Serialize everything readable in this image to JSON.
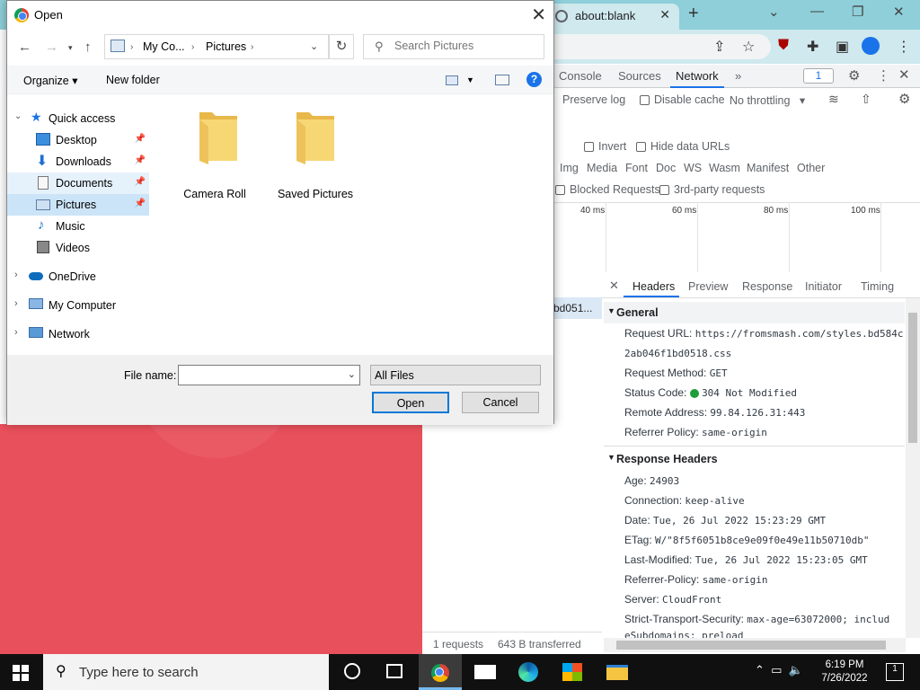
{
  "browser": {
    "tab_title": "about:blank",
    "new_tab_symbol": "+",
    "close_tab_symbol": "✕"
  },
  "devtools": {
    "tabs": [
      "Console",
      "Sources",
      "Network"
    ],
    "more_tabs": "»",
    "message_count": "1",
    "preserve_log": "Preserve log",
    "disable_cache": "Disable cache",
    "throttling": "No throttling",
    "invert": "Invert",
    "hide_data_urls": "Hide data URLs",
    "filters": [
      "Img",
      "Media",
      "Font",
      "Doc",
      "WS",
      "Wasm",
      "Manifest",
      "Other"
    ],
    "blocked_requests": "Blocked Requests",
    "third_party": "3rd-party requests",
    "timeline_ticks": [
      "40 ms",
      "60 ms",
      "80 ms",
      "100 ms"
    ],
    "request_name": "bd051...",
    "detail_tabs": [
      "Headers",
      "Preview",
      "Response",
      "Initiator",
      "Timing"
    ],
    "general": {
      "title": "General",
      "request_url_label": "Request URL:",
      "request_url": "https://fromsmash.com/styles.bd584c",
      "request_url_cont": "2ab046f1bd0518.css",
      "request_method_label": "Request Method:",
      "request_method": "GET",
      "status_code_label": "Status Code:",
      "status_code": "304 Not Modified",
      "remote_address_label": "Remote Address:",
      "remote_address": "99.84.126.31:443",
      "referrer_policy_label": "Referrer Policy:",
      "referrer_policy": "same-origin"
    },
    "response_headers": {
      "title": "Response Headers",
      "rows": [
        {
          "k": "Age:",
          "v": "24903"
        },
        {
          "k": "Connection:",
          "v": "keep-alive"
        },
        {
          "k": "Date:",
          "v": "Tue, 26 Jul 2022 15:23:29 GMT"
        },
        {
          "k": "ETag:",
          "v": "W/\"8f5f6051b8ce9e09f0e49e11b50710db\""
        },
        {
          "k": "Last-Modified:",
          "v": "Tue, 26 Jul 2022 15:23:05 GMT"
        },
        {
          "k": "Referrer-Policy:",
          "v": "same-origin"
        },
        {
          "k": "Server:",
          "v": "CloudFront"
        },
        {
          "k": "Strict-Transport-Security:",
          "v": "max-age=63072000; includ"
        },
        {
          "k": "",
          "v": "eSubdomains; preload"
        }
      ]
    },
    "status": {
      "requests": "1 requests",
      "transferred": "643 B transferred"
    }
  },
  "dialog": {
    "title": "Open",
    "path": [
      "My Co...",
      "Pictures"
    ],
    "search_placeholder": "Search Pictures",
    "organize": "Organize ▾",
    "new_folder": "New folder",
    "sidebar": [
      {
        "label": "Quick access"
      },
      {
        "label": "Desktop"
      },
      {
        "label": "Downloads"
      },
      {
        "label": "Documents"
      },
      {
        "label": "Pictures"
      },
      {
        "label": "Music"
      },
      {
        "label": "Videos"
      },
      {
        "label": "OneDrive"
      },
      {
        "label": "My Computer"
      },
      {
        "label": "Network"
      }
    ],
    "files": [
      {
        "label": "Camera Roll"
      },
      {
        "label": "Saved Pictures"
      }
    ],
    "file_name_label": "File name:",
    "file_name_value": "",
    "file_type": "All Files",
    "open_button": "Open",
    "cancel_button": "Cancel"
  },
  "taskbar": {
    "search_placeholder": "Type here to search",
    "time": "6:19 PM",
    "date": "7/26/2022",
    "notification_count": "1"
  },
  "colors": {
    "accent": "#0078d7",
    "page_bg": "#e8505b",
    "tabstrip": "#8ecfd9",
    "status_ok": "#1e9e3a"
  },
  "icons": [
    "chrome-icon",
    "globe-icon",
    "close-icon",
    "plus-icon",
    "minimize-icon",
    "maximize-icon",
    "share-icon",
    "star-icon",
    "extension-icon",
    "sidebar-icon",
    "profile-icon",
    "menu-icon",
    "gear-icon",
    "back-icon",
    "forward-icon",
    "up-icon",
    "refresh-icon",
    "search-icon",
    "folder-icon",
    "pin-icon",
    "windows-icon",
    "task-view-icon",
    "mail-icon",
    "edge-icon",
    "store-icon",
    "explorer-icon"
  ]
}
